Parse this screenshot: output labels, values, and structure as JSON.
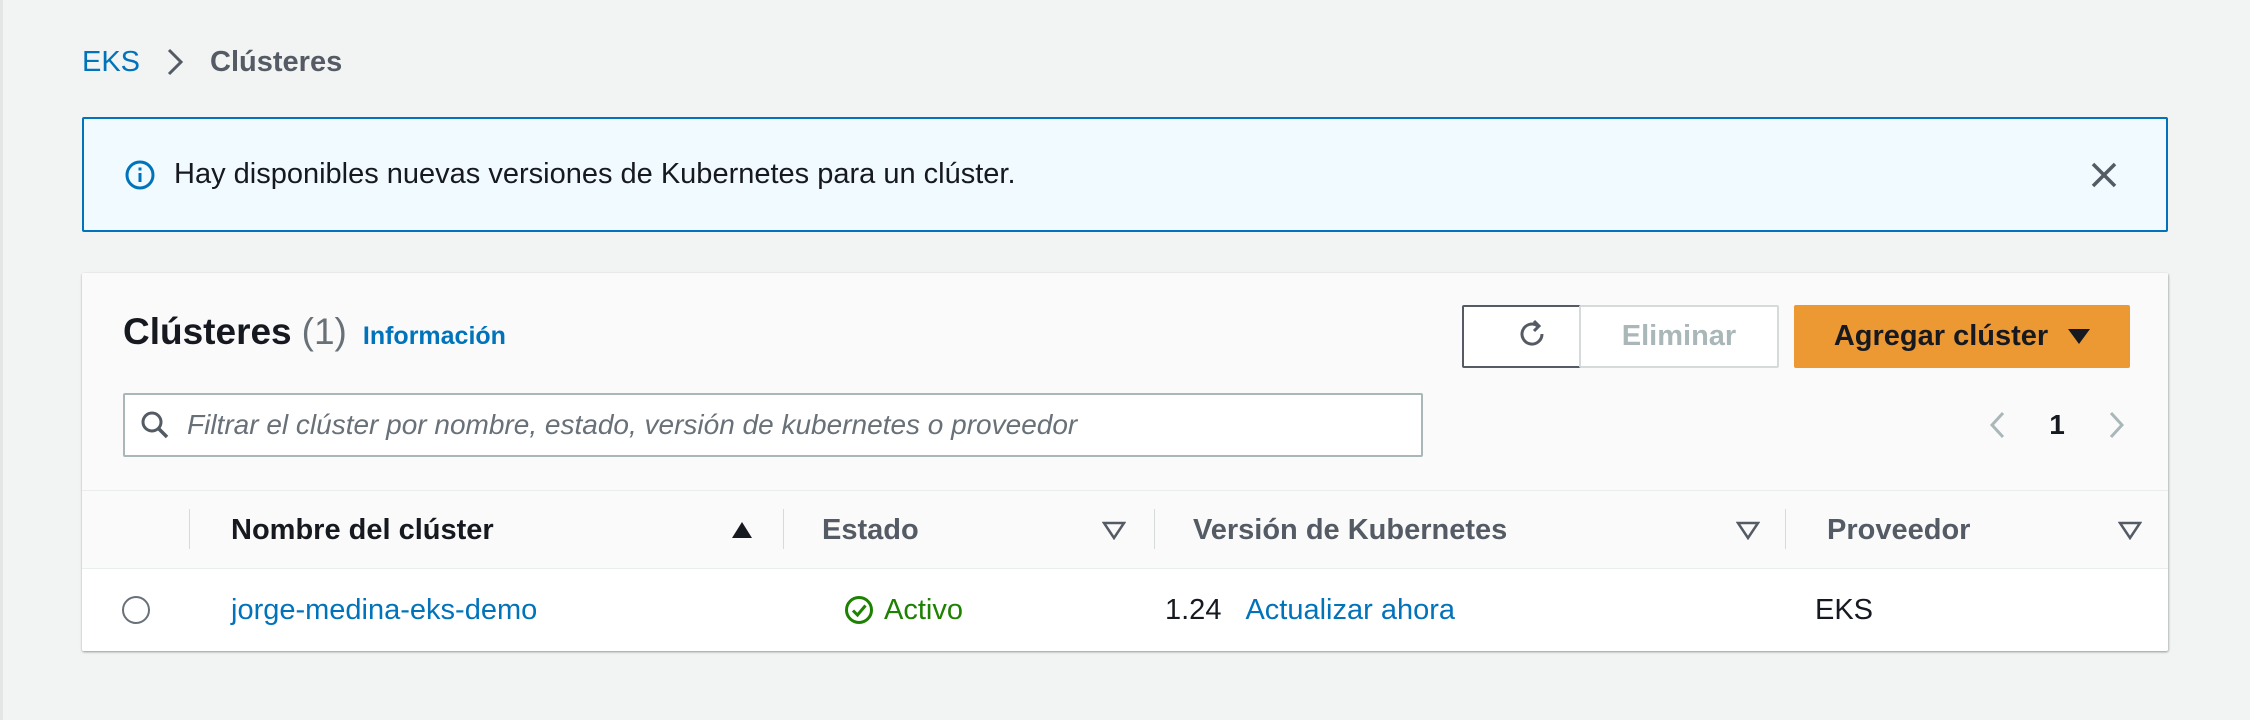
{
  "breadcrumb": {
    "root": "EKS",
    "current": "Clústeres"
  },
  "flash": {
    "icon": "info-icon",
    "message": "Hay disponibles nuevas versiones de Kubernetes para un clúster."
  },
  "clusters": {
    "title": "Clústeres",
    "count": "(1)",
    "info_link": "Información",
    "buttons": {
      "refresh_icon": "refresh-icon",
      "delete": "Eliminar",
      "add": "Agregar clúster"
    },
    "search": {
      "placeholder": "Filtrar el clúster por nombre, estado, versión de kubernetes o proveedor"
    },
    "pagination": {
      "page": "1"
    },
    "columns": [
      {
        "label": "Nombre del clúster",
        "sort": "ascending"
      },
      {
        "label": "Estado",
        "sort": "none"
      },
      {
        "label": "Versión de Kubernetes",
        "sort": "none"
      },
      {
        "label": "Proveedor",
        "sort": "none"
      }
    ],
    "rows": [
      {
        "name": "jorge-medina-eks-demo",
        "status": "Activo",
        "version": "1.24",
        "version_action": "Actualizar ahora",
        "provider": "EKS"
      }
    ]
  },
  "colors": {
    "link": "#0073bb",
    "primary_button": "#ec9933",
    "status_active": "#1d8102",
    "flash_border": "#0073bb",
    "flash_bg": "#f1faff"
  }
}
